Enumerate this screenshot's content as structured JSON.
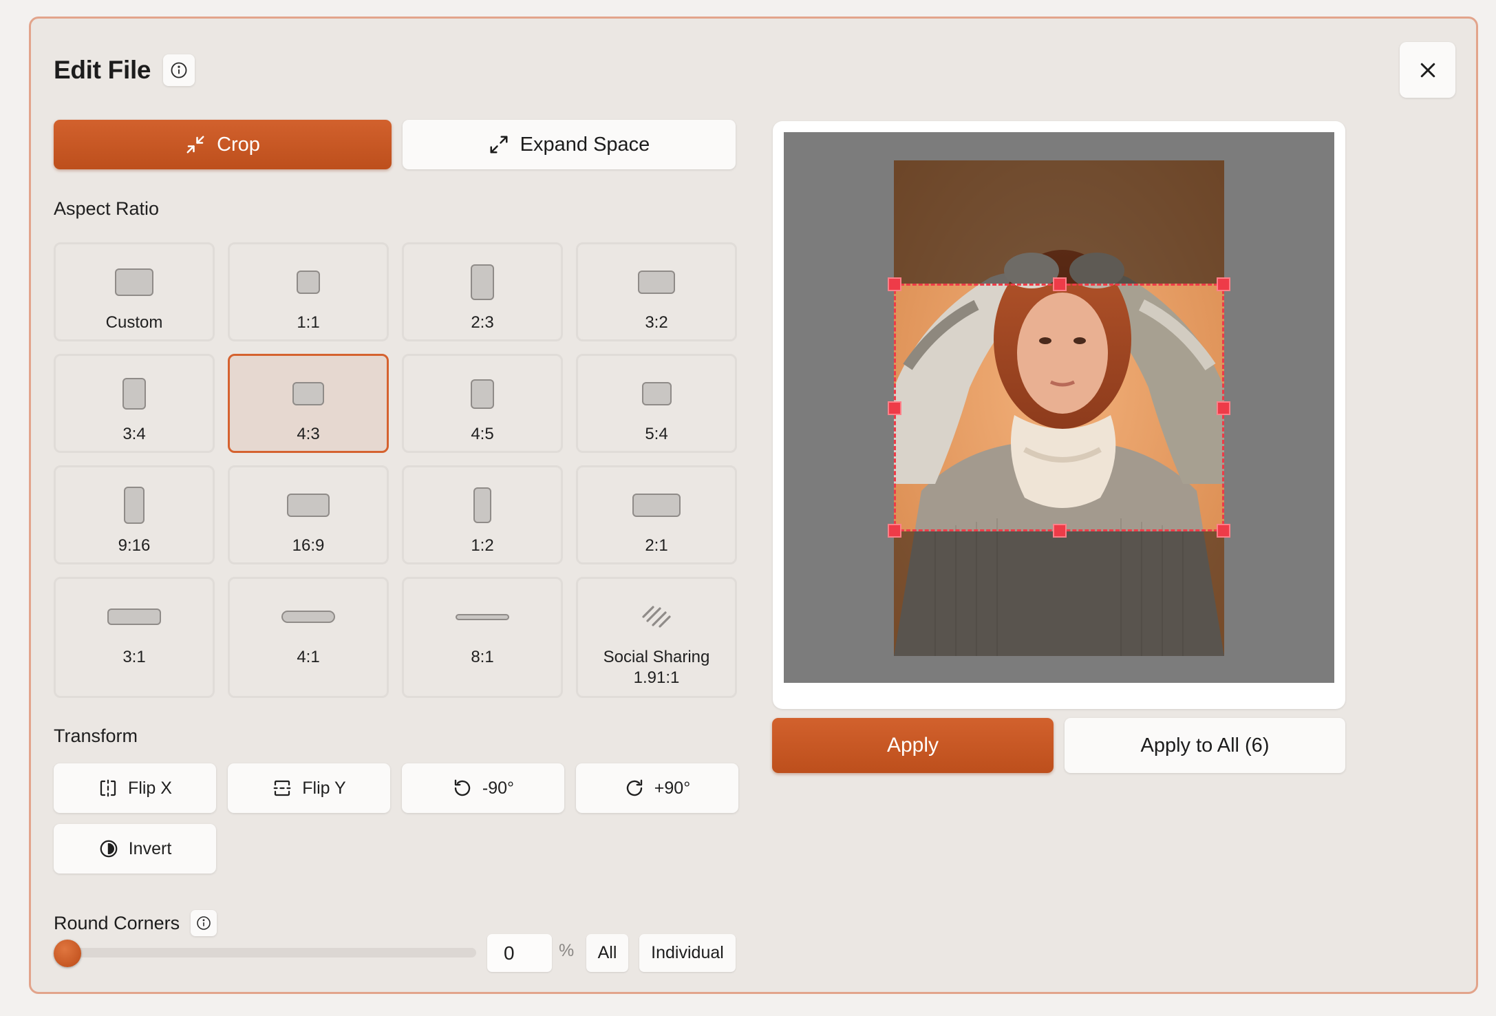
{
  "dialog": {
    "title": "Edit File",
    "info_icon": "info-circle-icon",
    "close_icon": "close-x-icon"
  },
  "modes": {
    "crop": "Crop",
    "expand": "Expand Space",
    "active": "Crop"
  },
  "aspect_ratio": {
    "title": "Aspect Ratio",
    "selected": "4:3",
    "options": [
      "Custom",
      "1:1",
      "2:3",
      "3:2",
      "3:4",
      "4:3",
      "4:5",
      "5:4",
      "9:16",
      "16:9",
      "1:2",
      "2:1",
      "3:1",
      "4:1",
      "8:1"
    ],
    "social": {
      "line1": "Social Sharing",
      "line2": "1.91:1",
      "icon": "squarespace-logo-icon"
    }
  },
  "transform": {
    "title": "Transform",
    "flip_x": "Flip X",
    "flip_y": "Flip Y",
    "rotate_left": "-90°",
    "rotate_right": "+90°",
    "invert": "Invert"
  },
  "round_corners": {
    "title": "Round Corners",
    "value": "0",
    "unit": "%",
    "slider_value": 0,
    "all": "All",
    "individual": "Individual"
  },
  "actions": {
    "apply": "Apply",
    "apply_all": "Apply to All (6)"
  },
  "colors": {
    "accent": "#c9561f",
    "crop_handle": "#ee3b48",
    "dialog_border": "#e2a48b"
  }
}
